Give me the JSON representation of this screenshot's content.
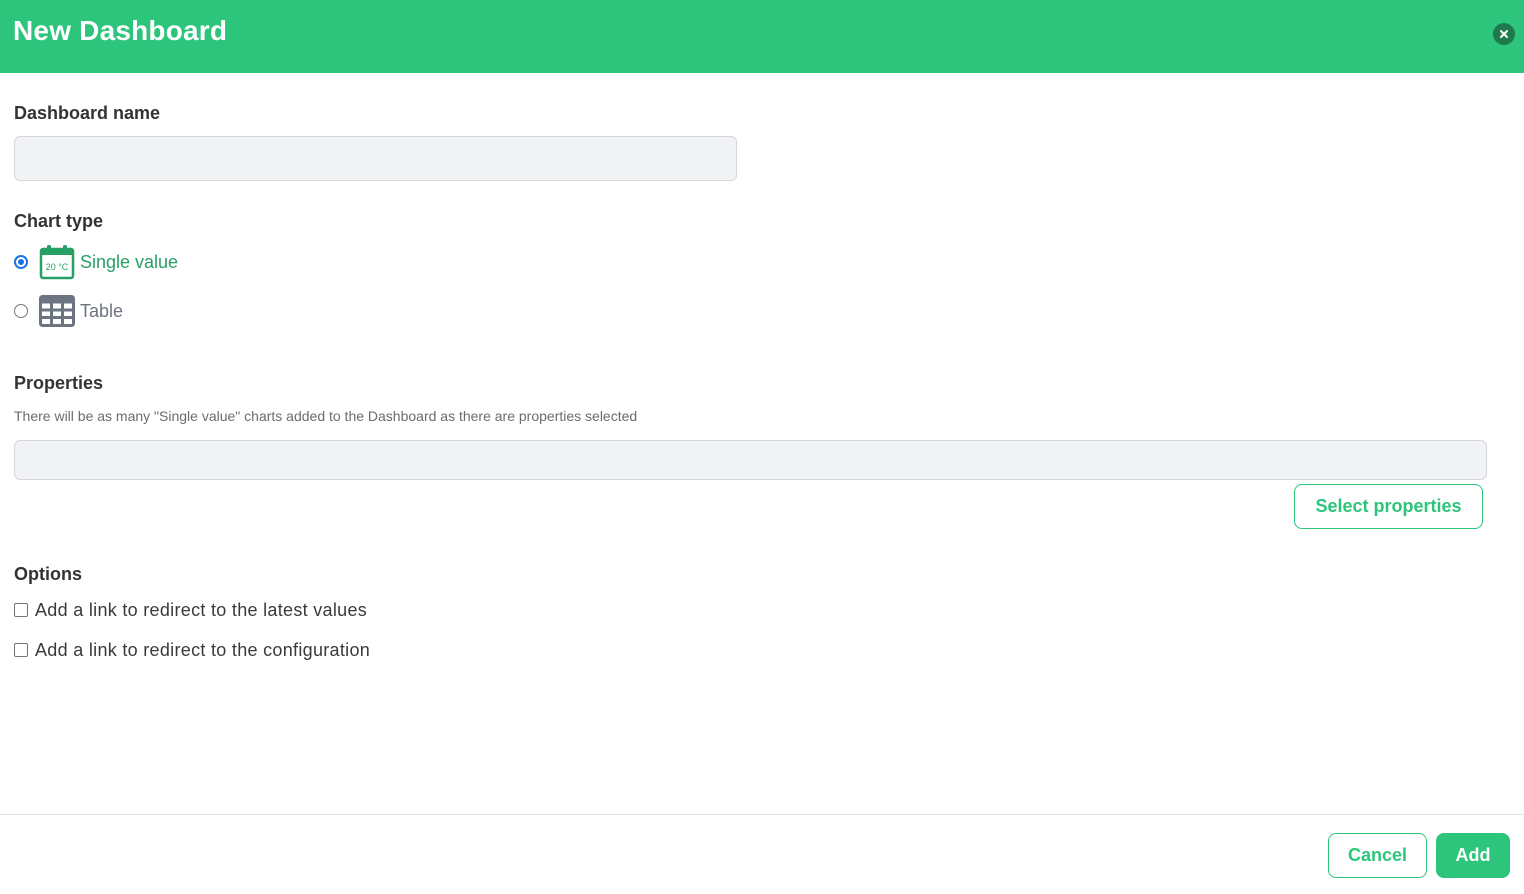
{
  "dialog": {
    "title": "New Dashboard",
    "close_icon": "close-icon",
    "accent_color": "#2dc57b"
  },
  "name_field": {
    "label": "Dashboard name",
    "value": "",
    "placeholder": ""
  },
  "chart_type": {
    "label": "Chart type",
    "options": [
      {
        "label": "Single value",
        "icon": "thermometer-calendar-icon",
        "icon_text": "20 °C",
        "selected": true
      },
      {
        "label": "Table",
        "icon": "table-icon",
        "selected": false
      }
    ]
  },
  "properties": {
    "label": "Properties",
    "hint": "There will be as many \"Single value\" charts added to the Dashboard as there are properties selected",
    "value": "",
    "select_button": "Select properties"
  },
  "options": {
    "label": "Options",
    "items": [
      {
        "label": "Add a link to redirect to the latest values",
        "checked": false
      },
      {
        "label": "Add a link to redirect to the configuration",
        "checked": false
      }
    ]
  },
  "footer": {
    "cancel_label": "Cancel",
    "add_label": "Add"
  }
}
